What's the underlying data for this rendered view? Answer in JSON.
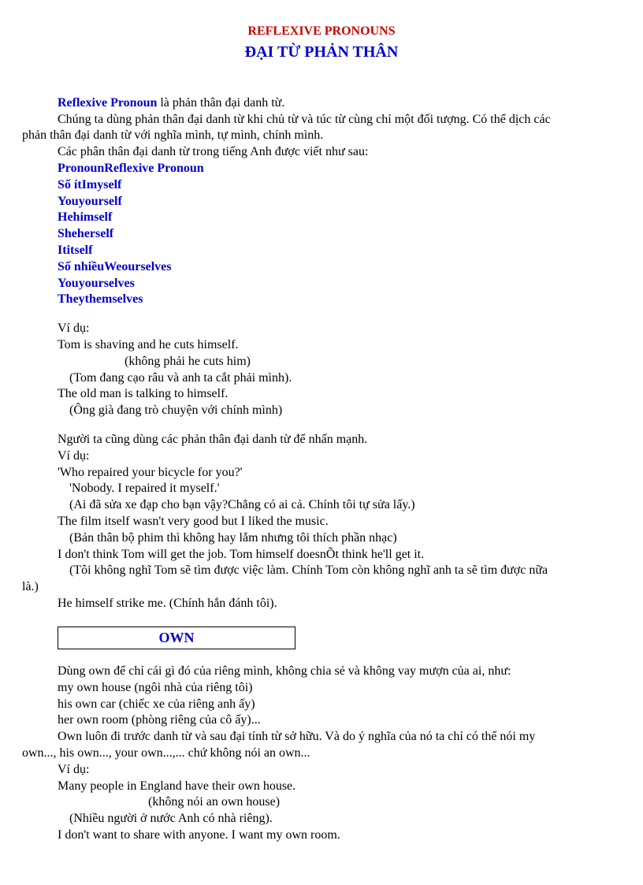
{
  "title1": "REFLEXIVE  PRONOUNS",
  "title2": "ĐẠI TỪ PHẢN THÂN",
  "intro": {
    "term": "Reflexive Pronoun",
    "def": " là phản thân đại danh từ.",
    "p1a": "Chúng ta dùng phản thân đại danh từ khi chủ từ và túc từ cùng chỉ một đối tượng. Có thể dịch các",
    "p1b": "phản thân đại danh từ với nghĩa mình, tự mình, chính mình.",
    "p2": "Các phân thân đại danh từ trong tiếng Anh được viết như sau:"
  },
  "table": {
    "header1": "Pronoun",
    "header2": "Reflexive Pronoun",
    "singular_label": "Số ít",
    "plural_label": "Số nhiều",
    "r1a": "I",
    "r1b": "myself",
    "r2a": "You",
    "r2b": "yourself",
    "r3a": "He",
    "r3b": "himself",
    "r4a": "She",
    "r4b": "herself",
    "r5a": "It",
    "r5b": "itself",
    "r6a": "We",
    "r6b": "ourselves",
    "r7a": "You",
    "r7b": "yourselves",
    "r8a": "They",
    "r8b": "themselves"
  },
  "ex": {
    "vd": "Ví dụ:",
    "l1": "Tom is shaving and he cuts himself.",
    "l2": "(không phải he cuts him)",
    "l3": "(Tom đang cạo râu và anh ta cắt phải mình).",
    "l4": "The old man is talking to himself.",
    "l5": "(Ông già đang trò chuyện với chính mình)",
    "l6": "Người ta cũng dùng các phản thân đại danh từ để nhấn mạnh.",
    "l7": "Ví dụ:",
    "l8": "'Who repaired your bicycle for you?'",
    "l9": "'Nobody. I repaired it myself.'",
    "l10": "(Ai đã sửa xe đạp cho bạn vậy?Chẳng  có ai cả. Chính tôi tự sửa lấy.)",
    "l11": "The film itself wasn't very good but I liked the music.",
    "l12": "(Bản thân bộ phim thì không hay lắm nhưng tôi thích phần nhạc)",
    "l13": "I don't think Tom will get the job. Tom himself doesnÕt think he'll get it.",
    "l14a": "(Tôi không nghĩ Tom sẽ tìm được việc làm. Chính Tom còn không nghĩ anh ta sẽ tìm được nữa",
    "l14b": "là.)",
    "l15": "He himself strike me. (Chính hắn  đánh tôi)."
  },
  "own": {
    "heading": "OWN",
    "p1": "Dùng own để chỉ cái gì đó của riêng mình, không chia sẻ và không vay mượn của ai, như:",
    "p2": "my own house (ngôi nhà của riêng tôi)",
    "p3": "his own car (chiếc xe của riêng anh ấy)",
    "p4": "her own room (phòng riêng của cô ấy)...",
    "p5a": "Own luôn đi trước danh từ và sau đại tính từ sở hữu. Và do ý nghĩa của nó ta chỉ có thể nói my",
    "p5b": "own..., his own..., your own...,... chứ không nói an own...",
    "p6": "Ví dụ:",
    "p7": "Many people in England have their own house.",
    "p8": "(không nói an own house)",
    "p9": "(Nhiều người ở nước Anh có nhà riêng).",
    "p10": "I don't want to share with anyone. I want my own room."
  }
}
